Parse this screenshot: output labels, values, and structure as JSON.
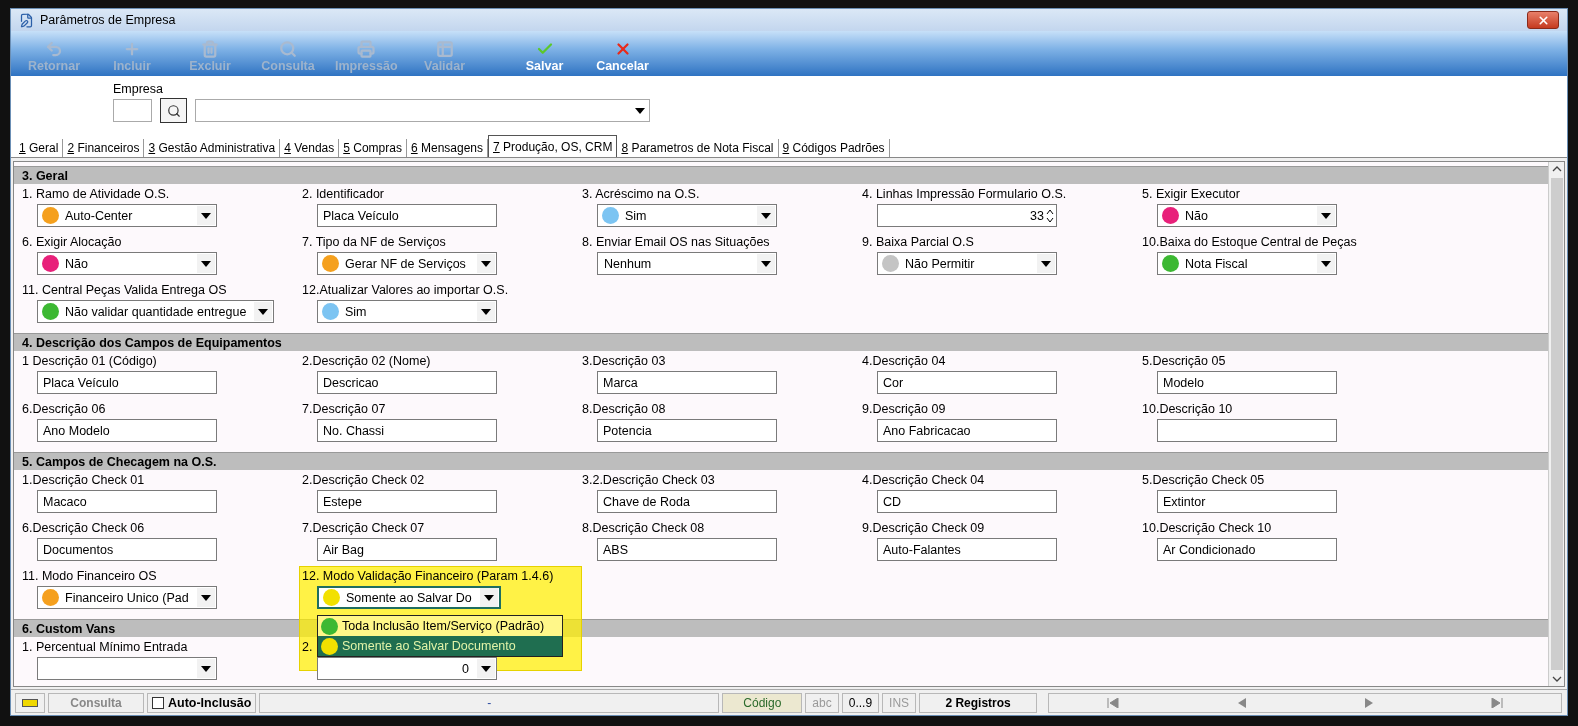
{
  "window": {
    "title": "Parâmetros de Empresa"
  },
  "toolbar": [
    {
      "label": "Retornar",
      "kind": "undo",
      "disabled": true
    },
    {
      "label": "Incluir",
      "kind": "plus",
      "disabled": true
    },
    {
      "label": "Excluir",
      "kind": "trash",
      "disabled": true
    },
    {
      "label": "Consulta",
      "kind": "search",
      "disabled": true
    },
    {
      "label": "Impressão",
      "kind": "printer",
      "disabled": true
    },
    {
      "label": "Validar",
      "kind": "table",
      "disabled": true
    },
    {
      "label": "Salvar",
      "kind": "check",
      "disabled": false
    },
    {
      "label": "Cancelar",
      "kind": "x",
      "disabled": false
    }
  ],
  "empresa": {
    "label": "Empresa"
  },
  "tabs": [
    {
      "label": "1 Geral",
      "selected": false
    },
    {
      "label": "2 Financeiros",
      "selected": false
    },
    {
      "label": "3 Gestão Administrativa",
      "selected": false
    },
    {
      "label": "4 Vendas",
      "selected": false
    },
    {
      "label": "5 Compras",
      "selected": false
    },
    {
      "label": "6 Mensagens",
      "selected": false
    },
    {
      "label": "7 Produção, OS, CRM",
      "selected": true
    },
    {
      "label": "8 Parametros de Nota Fiscal",
      "selected": false
    },
    {
      "label": "9 Códigos Padrões",
      "selected": false
    }
  ],
  "sections": [
    {
      "title": "3. Geral",
      "fields": [
        {
          "label": "1. Ramo de Atividade O.S.",
          "kind": "combo",
          "value": "Auto-Center",
          "color": "#f5a01e"
        },
        {
          "label": "2. Identificador",
          "kind": "text",
          "value": "Placa Veículo"
        },
        {
          "label": "3. Acréscimo na O.S.",
          "kind": "combo",
          "value": "Sim",
          "color": "#7cc4f2"
        },
        {
          "label": "4. Linhas Impressão Formulario O.S.",
          "kind": "spin",
          "value": "33"
        },
        {
          "label": "5. Exigir Executor",
          "kind": "combo",
          "value": "Não",
          "color": "#e8207a"
        },
        {
          "label": "6. Exigir Alocação",
          "kind": "combo",
          "value": "Não",
          "color": "#e8207a"
        },
        {
          "label": "7. Tipo da NF de Serviços",
          "kind": "combo",
          "value": "Gerar NF de Serviços",
          "color": "#f5a01e"
        },
        {
          "label": "8. Enviar Email OS nas Situações",
          "kind": "combo",
          "value": "Nenhum"
        },
        {
          "label": "9. Baixa Parcial O.S",
          "kind": "combo",
          "value": "Não Permitir",
          "color": "#c4c4c4"
        },
        {
          "label": "10.Baixa do Estoque Central de Peças",
          "kind": "combo",
          "value": "Nota Fiscal",
          "color": "#3cb832"
        },
        {
          "label": "11. Central Peças Valida Entrega OS",
          "kind": "combo",
          "value": "Não validar quantidade entregue",
          "color": "#3cb832"
        },
        {
          "label": "12.Atualizar Valores ao importar O.S.",
          "kind": "combo",
          "value": "Sim",
          "color": "#7cc4f2"
        }
      ]
    },
    {
      "title": "4. Descrição dos Campos de Equipamentos",
      "fields": [
        {
          "label": "1 Descrição 01 (Código)",
          "kind": "text",
          "value": "Placa Veículo"
        },
        {
          "label": "2.Descrição 02 (Nome)",
          "kind": "text",
          "value": "Descricao"
        },
        {
          "label": "3.Descrição 03",
          "kind": "text",
          "value": "Marca"
        },
        {
          "label": "4.Descrição 04",
          "kind": "text",
          "value": "Cor"
        },
        {
          "label": "5.Descrição 05",
          "kind": "text",
          "value": "Modelo"
        },
        {
          "label": "6.Descrição 06",
          "kind": "text",
          "value": "Ano Modelo"
        },
        {
          "label": "7.Descrição 07",
          "kind": "text",
          "value": "No. Chassi"
        },
        {
          "label": "8.Descrição 08",
          "kind": "text",
          "value": "Potencia"
        },
        {
          "label": "9.Descrição 09",
          "kind": "text",
          "value": "Ano Fabricacao"
        },
        {
          "label": "10.Descrição 10",
          "kind": "text"
        }
      ]
    },
    {
      "title": "5. Campos de Checagem na O.S.",
      "fields": [
        {
          "label": "1.Descrição Check 01",
          "kind": "text",
          "value": "Macaco"
        },
        {
          "label": "2.Descrição Check 02",
          "kind": "text",
          "value": "Estepe"
        },
        {
          "label": "3.2.Descrição Check 03",
          "kind": "text",
          "value": "Chave de Roda"
        },
        {
          "label": "4.Descrição Check 04",
          "kind": "text",
          "value": "CD"
        },
        {
          "label": "5.Descrição Check 05",
          "kind": "text",
          "value": "Extintor"
        },
        {
          "label": "6.Descrição Check 06",
          "kind": "text",
          "value": "Documentos"
        },
        {
          "label": "7.Descrição Check 07",
          "kind": "text",
          "value": "Air Bag"
        },
        {
          "label": "8.Descrição Check 08",
          "kind": "text",
          "value": "ABS"
        },
        {
          "label": "9.Descrição Check 09",
          "kind": "text",
          "value": "Auto-Falantes"
        },
        {
          "label": "10.Descrição Check 10",
          "kind": "text",
          "value": "Ar Condicionado"
        },
        {
          "label": "11. Modo Financeiro OS",
          "kind": "combo",
          "value": "Financeiro Unico (Pad",
          "color": "#f5a01e"
        },
        {
          "label": "12. Modo Validação Financeiro (Param 1.4.6)",
          "kind": "combo",
          "value": "Somente ao Salvar Do",
          "color": "#f2e000",
          "focused": true,
          "options": [
            {
              "label": "Toda Inclusão Item/Serviço (Padrão)",
              "color": "#3cb832",
              "selected": false
            },
            {
              "label": "Somente ao Salvar Documento",
              "color": "#f2e000",
              "selected": true
            }
          ]
        }
      ]
    },
    {
      "title": "6. Custom Vans",
      "fields": [
        {
          "label": "1. Percentual Mínimo Entrada",
          "kind": "combo"
        },
        {
          "label": "2.",
          "kind": "number",
          "value": "0"
        }
      ]
    }
  ],
  "status_bar": {
    "mode": "Consulta",
    "auto_inclusion": {
      "label": "Auto-Inclusão",
      "checked": false
    },
    "message": "-",
    "key_field": "Código",
    "abc": "abc",
    "digits": "0...9",
    "ins": "INS",
    "records": "2 Registros"
  }
}
